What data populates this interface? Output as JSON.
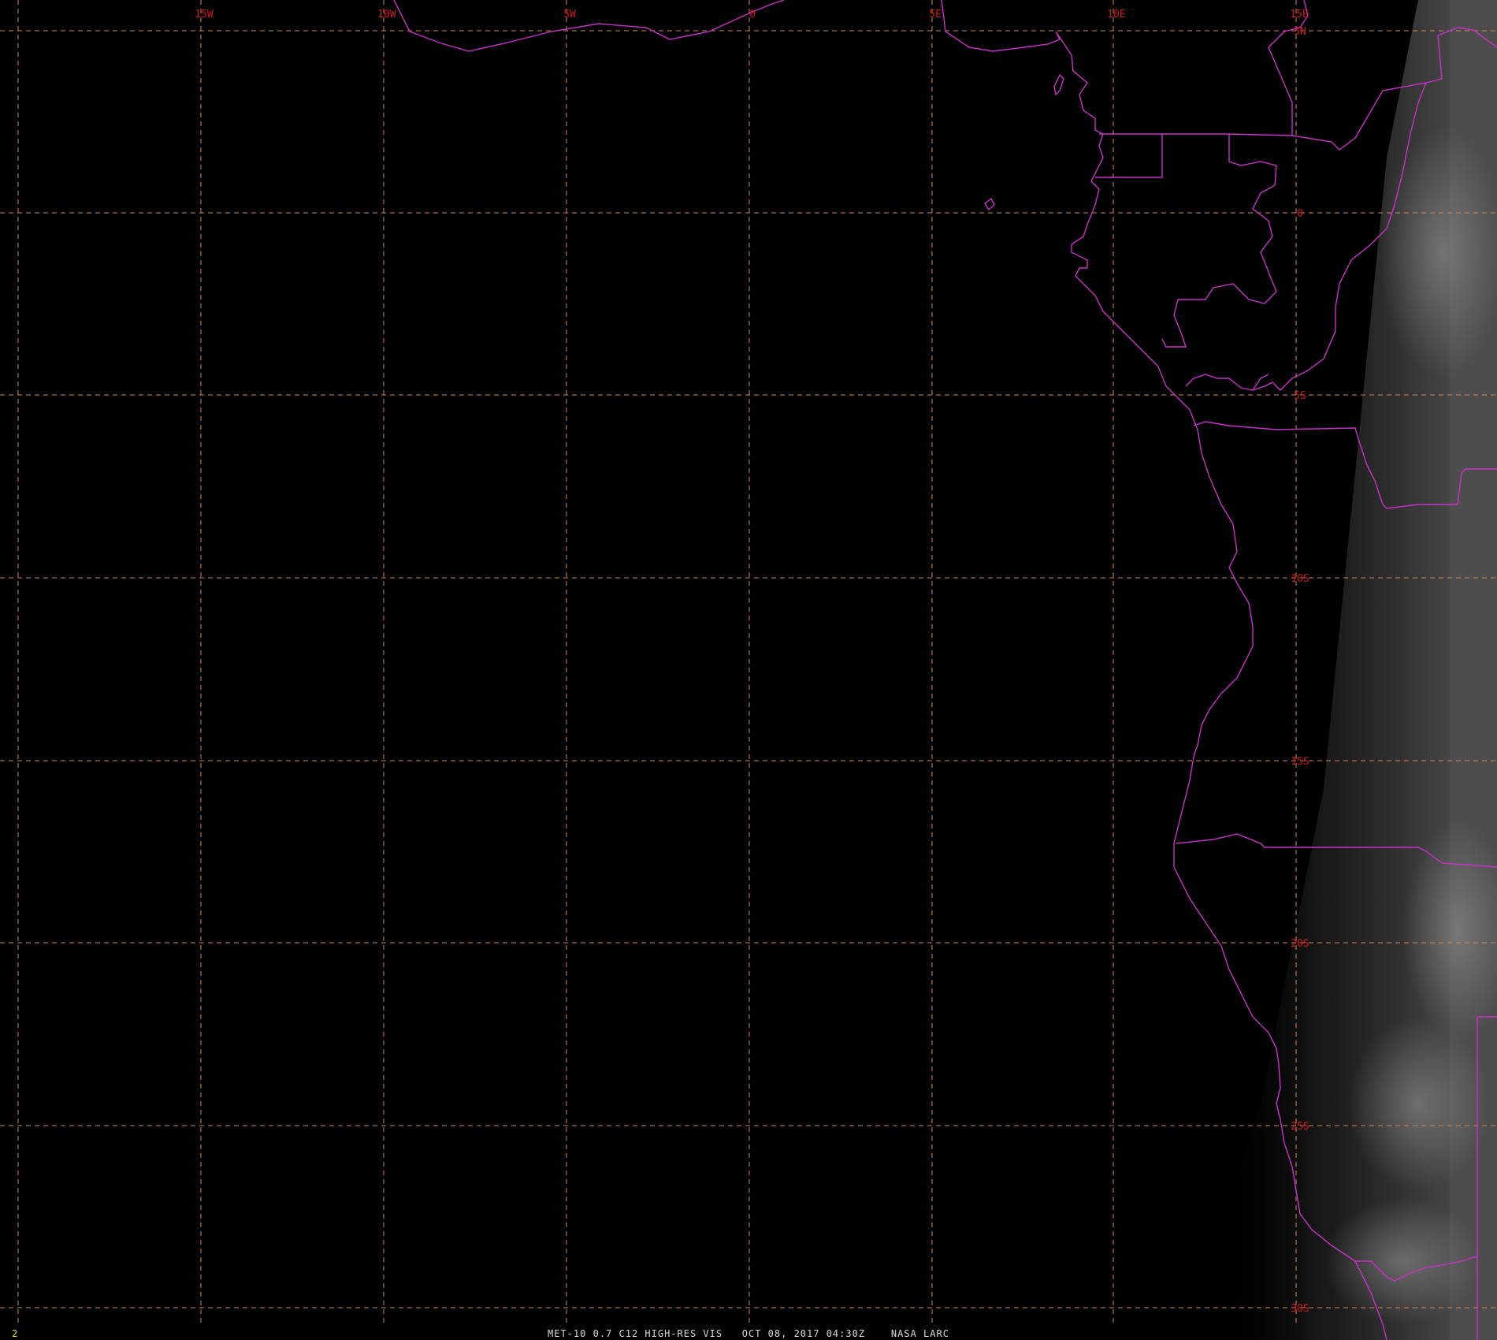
{
  "map": {
    "background_color": "#000000",
    "grid_color": "#d08850",
    "label_color": "#cc1a1a",
    "coast_color": "#c832c8",
    "longitude_labels": [
      "15W",
      "10W",
      "5W",
      "0",
      "5E",
      "10E",
      "15E"
    ],
    "latitude_labels": [
      "5N",
      "0",
      "5S",
      "10S",
      "15S",
      "20S",
      "25S",
      "30S"
    ],
    "frame_number": "2",
    "caption": "MET-10 0.7 C12 HIGH-RES VIS   OCT 08, 2017 04:30Z    NASA LARC"
  }
}
